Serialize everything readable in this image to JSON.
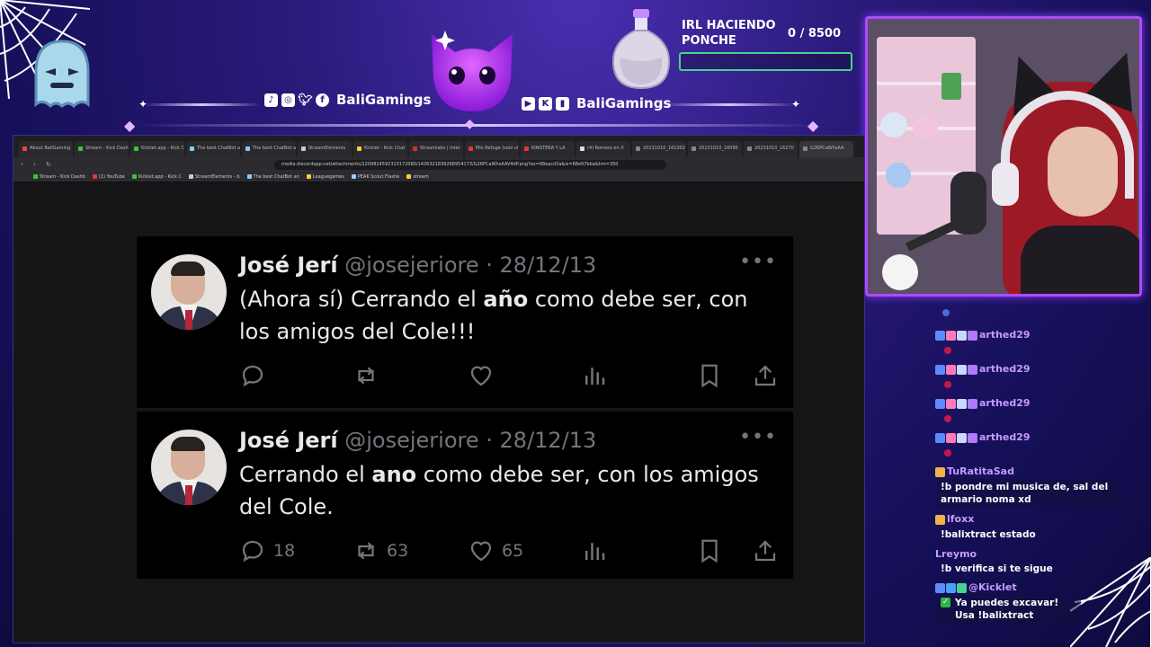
{
  "overlay": {
    "channel_left": "BaliGamings",
    "channel_right": "BaliGamings",
    "social_left_icons": [
      "tiktok-icon",
      "instagram-icon",
      "twitter-icon",
      "facebook-icon"
    ],
    "social_right_icons": [
      "youtube-icon",
      "kick-icon",
      "twitch-icon"
    ],
    "goal_title": "IRL HACIENDO PONCHE",
    "goal_count": "0  / 8500",
    "goal_progress": 0.0,
    "accent_color": "#b04aff",
    "goal_color": "#45d38f"
  },
  "browser": {
    "tabs": [
      {
        "label": "About BaliGaming",
        "fav": "#e44"
      },
      {
        "label": "Stream - Kick Dash",
        "fav": "#3c3"
      },
      {
        "label": "Kicklet.app - Kick C",
        "fav": "#3c3"
      },
      {
        "label": "The best ChatBot a",
        "fav": "#8cf"
      },
      {
        "label": "The best ChatBot a",
        "fav": "#8cf"
      },
      {
        "label": "StreamElements",
        "fav": "#ccc"
      },
      {
        "label": "Kicklet - Kick Chat",
        "fav": "#fc3"
      },
      {
        "label": "Streamlabs | Inter",
        "fav": "#c33"
      },
      {
        "label": "Mix Refuge (solo vi",
        "fav": "#e33"
      },
      {
        "label": "KINGTEKA Y LA",
        "fav": "#e33"
      },
      {
        "label": "(4) Romero en X",
        "fav": "#ddd"
      },
      {
        "label": "20231010_161002",
        "fav": "#888"
      },
      {
        "label": "20231010_16095",
        "fav": "#888"
      },
      {
        "label": "20231010_16270",
        "fav": "#888"
      },
      {
        "label": "G26PCaWhsAA",
        "fav": "#888"
      }
    ],
    "url": "media.discordapp.net/attachments/1209814592313172060/1426321839268954173/G26PCaWhsAAV4dP.png?ex=68eacd3a&is=68e97bba&hm=350",
    "bookmarks": [
      {
        "label": "Stream - Kick Dashb",
        "color": "#3c3"
      },
      {
        "label": "(1) YouTube",
        "color": "#e33"
      },
      {
        "label": "Kicklet.app - Kick C",
        "color": "#3c3"
      },
      {
        "label": "StreamElements - b",
        "color": "#ccc"
      },
      {
        "label": "The best ChatBot an",
        "color": "#8cf"
      },
      {
        "label": "Leaguegames",
        "color": "#fc3"
      },
      {
        "label": "PEAK Scout Flashe",
        "color": "#9cf"
      },
      {
        "label": "stream",
        "color": "#fc3"
      }
    ]
  },
  "tweets": [
    {
      "name": "José Jerí",
      "handle": "@josejeriore",
      "date": "· 28/12/13",
      "text_a": "(Ahora sí) Cerrando el ",
      "text_bold": "año",
      "text_b": " como debe ser, con los amigos del Cole!!!",
      "replies": "",
      "retweets": "",
      "likes": ""
    },
    {
      "name": "José Jerí",
      "handle": "@josejeriore",
      "date": "· 28/12/13",
      "text_a": "Cerrando el ",
      "text_bold": "ano",
      "text_b": " como debe ser, con los amigos del Cole.",
      "replies": "18",
      "retweets": "63",
      "likes": "65"
    }
  ],
  "chat": {
    "messages": [
      {
        "user": "arthed29",
        "text": ""
      },
      {
        "user": "arthed29",
        "text": ""
      },
      {
        "user": "arthed29",
        "text": ""
      },
      {
        "user": "arthed29",
        "text": ""
      },
      {
        "user": "TuRatitaSad",
        "text": "!b pondre mi musica de, sal del armario noma xd"
      },
      {
        "user": "lfoxx",
        "text": "!balixtract estado"
      },
      {
        "user": "Lreymo",
        "text": "!b verifica si te sigue"
      },
      {
        "user": "@Kicklet",
        "text": "Ya puedes excavar! Usa !balixtract"
      }
    ]
  }
}
